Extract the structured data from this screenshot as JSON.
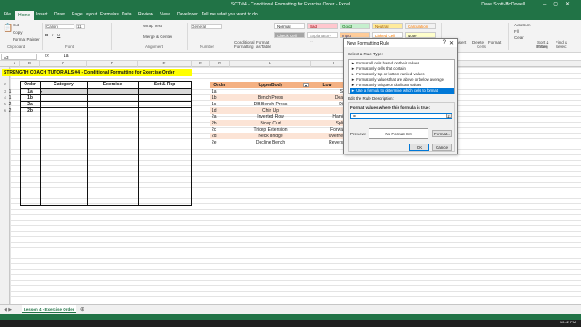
{
  "window": {
    "title": "SCT #4 - Conditional Formatting for Exercise Order - Excel",
    "user": "Dave Scott-McDowell"
  },
  "ribbon_tabs": [
    "File",
    "Home",
    "Insert",
    "Draw",
    "Page Layout",
    "Formulas",
    "Data",
    "Review",
    "View",
    "Developer",
    "Tell me what you want to do"
  ],
  "ribbon": {
    "cut": "Cut",
    "copy": "Copy",
    "format_painter": "Format Painter",
    "clipboard": "Clipboard",
    "font_name": "Calibri",
    "font_size": "11",
    "font_group": "Font",
    "wrap": "Wrap Text",
    "merge": "Merge & Center",
    "alignment": "Alignment",
    "number_format": "General",
    "number": "Number",
    "cond_fmt": "Conditional Formatting",
    "format_table": "Format as Table",
    "style_normal": "Normal",
    "style_bad": "Bad",
    "style_good": "Good",
    "style_neutral": "Neutral",
    "style_calc": "Calculation",
    "style_check": "Check Cell",
    "style_expl": "Explanatory ...",
    "style_input": "Input",
    "style_linked": "Linked Cell",
    "style_note": "Note",
    "styles": "Styles",
    "insert": "Insert",
    "delete": "Delete",
    "format": "Format",
    "cells": "Cells",
    "autosum": "AutoSum",
    "fill": "Fill",
    "clear": "Clear",
    "sort": "Sort & Filter",
    "find": "Find & Select",
    "editing": "Editing"
  },
  "formula_bar": {
    "name_box": "A3",
    "content": "1a"
  },
  "columns": [
    "A",
    "B",
    "C",
    "D",
    "E",
    "F",
    "G",
    "H",
    "I"
  ],
  "sheet": {
    "banner": "STRENGTH COACH TUTORIALS #4 - Conditional Formatting for Exercise Order",
    "left_headers": [
      "Order",
      "Category",
      "Exercise",
      "Set & Rep"
    ],
    "left_rows": [
      [
        "1",
        "1a"
      ],
      [
        "1",
        "1b"
      ],
      [
        "2",
        "2a"
      ],
      [
        "2",
        "2b"
      ]
    ],
    "right_headers": [
      "Order",
      "UpperBody",
      "Low"
    ],
    "right_rows": [
      [
        "1a",
        "",
        "S"
      ],
      [
        "1b",
        "Bench Press",
        "Dea"
      ],
      [
        "1c",
        "DB Bench Press",
        "Di"
      ],
      [
        "1d",
        "Chin Up",
        ""
      ],
      [
        "2a",
        "Inverted Row",
        "Hami"
      ],
      [
        "2b",
        "Bicep Curl",
        "Spli"
      ],
      [
        "2c",
        "Tricep Extension",
        "Forwa"
      ],
      [
        "2d",
        "Neck Bridge",
        "Overhe"
      ],
      [
        "2e",
        "Decline Bench",
        "Revers"
      ]
    ]
  },
  "dialog": {
    "title": "New Formatting Rule",
    "help": "?",
    "close": "✕",
    "select_label": "Select a Rule Type:",
    "rules": [
      "► Format all cells based on their values",
      "► Format only cells that contain",
      "► Format only top or bottom ranked values",
      "► Format only values that are above or below average",
      "► Format only unique or duplicate values",
      "► Use a formula to determine which cells to format"
    ],
    "edit_label": "Edit the Rule Description:",
    "formula_label": "Format values where this formula is true:",
    "formula_value": "=",
    "preview_label": "Preview:",
    "preview_text": "No Format Set",
    "format_btn": "Format...",
    "ok": "OK",
    "cancel": "Cancel"
  },
  "sheet_tab": "Lesson 4 - Exercise Order",
  "clock": "10:42 PM",
  "colors": {
    "excel_green": "#217346",
    "banner_yellow": "#ffff00",
    "header_orange": "#f4b183",
    "row_orange": "#fce4d6",
    "selected_blue": "#0078d7"
  }
}
